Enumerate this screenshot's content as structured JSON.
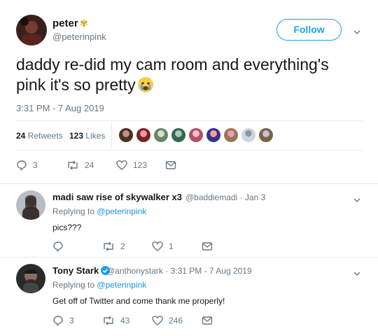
{
  "tweet": {
    "name": "peter",
    "name_emoji": "✾",
    "handle": "@peterinpink",
    "follow_label": "Follow",
    "text": "daddy re-did my cam room and everything's pink it's so pretty",
    "timestamp": "3:31 PM - 7 Aug 2019",
    "retweets_count": "24",
    "retweets_label": "Retweets",
    "likes_count": "123",
    "likes_label": "Likes",
    "actions": {
      "replies": "3",
      "retweets": "24",
      "likes": "123"
    }
  },
  "replies": [
    {
      "name": "madi saw rise of skywalker x3",
      "handle": "@baddiemadi",
      "date": "· Jan 3",
      "replying_prefix": "Replying to",
      "replying_to": "@peterinpink",
      "text": "pics???",
      "actions": {
        "replies": "",
        "retweets": "2",
        "likes": "1"
      }
    },
    {
      "name": "Tony Stark",
      "verified": true,
      "handle": "@anthonystark",
      "date": "· 3:31 PM - 7 Aug 2019",
      "replying_prefix": "Replying to",
      "replying_to": "@peterinpink",
      "text": "Get off of Twitter and come thank me properly!",
      "actions": {
        "replies": "3",
        "retweets": "43",
        "likes": "246"
      }
    }
  ],
  "colors": {
    "accent": "#1da1f2",
    "link": "#1b95e0",
    "secondary_text": "#657786",
    "divider": "#e6ecf0"
  },
  "icons": [
    "reply-icon",
    "retweet-icon",
    "like-icon",
    "message-icon",
    "chevron-down-icon",
    "verified-icon",
    "crying-face-emoji"
  ]
}
